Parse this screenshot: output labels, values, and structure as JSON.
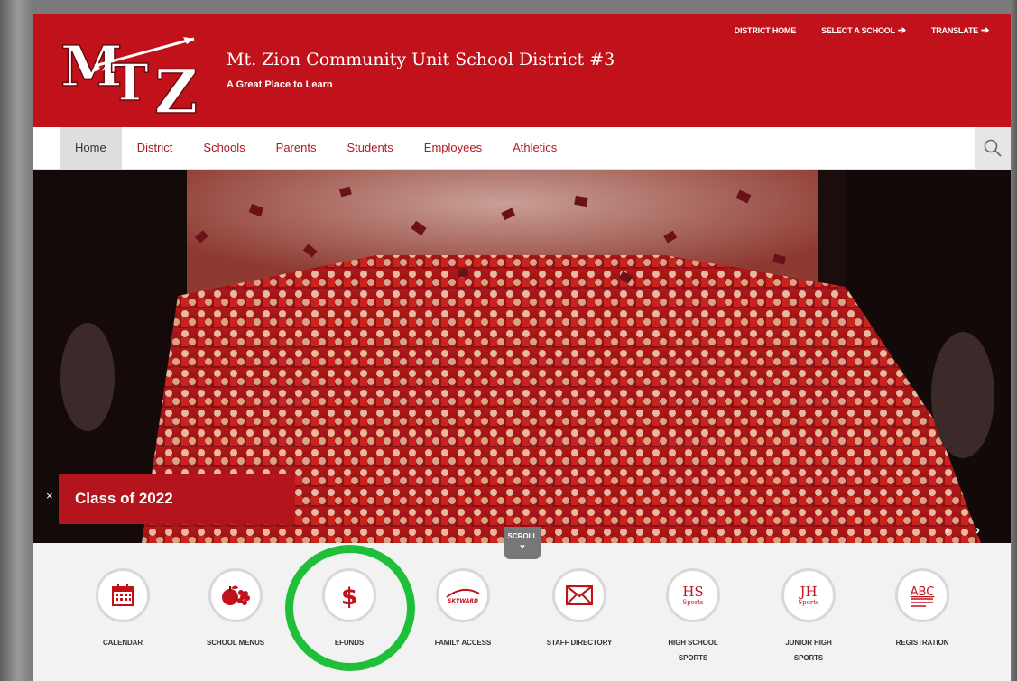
{
  "header": {
    "district_name": "Mt. Zion Community Unit School District #3",
    "tagline": "A Great Place to Learn",
    "logo_text": "MTZ",
    "utility_links": [
      {
        "label": "DISTRICT HOME",
        "arrow": ""
      },
      {
        "label": "SELECT A SCHOOL",
        "arrow": "➔"
      },
      {
        "label": "TRANSLATE",
        "arrow": "➔"
      }
    ]
  },
  "nav": {
    "items": [
      "Home",
      "District",
      "Schools",
      "Parents",
      "Students",
      "Employees",
      "Athletics"
    ],
    "active": "Home",
    "search_icon": "search-icon"
  },
  "hero": {
    "caption": "Class of 2022",
    "close": "×",
    "prev": "‹",
    "next": "›",
    "scroll_label": "SCROLL",
    "scroll_chevron": "⌄"
  },
  "quick_links": [
    {
      "label": "CALENDAR",
      "icon": "calendar-icon"
    },
    {
      "label": "SCHOOL MENUS",
      "icon": "fruit-icon"
    },
    {
      "label": "EFUNDS",
      "icon": "dollar-icon"
    },
    {
      "label": "FAMILY ACCESS",
      "icon": "skyward-icon",
      "icon_text": "SKYWARD"
    },
    {
      "label": "STAFF DIRECTORY",
      "icon": "envelope-icon"
    },
    {
      "label": "HIGH SCHOOL",
      "label2": "SPORTS",
      "icon": "hs-sports-icon",
      "icon_text": "HS",
      "icon_sub": "Sports"
    },
    {
      "label": "JUNIOR HIGH",
      "label2": "SPORTS",
      "icon": "jh-sports-icon",
      "icon_text": "JH",
      "icon_sub": "Sports"
    },
    {
      "label": "REGISTRATION",
      "icon": "abc-icon",
      "icon_text": "ABC"
    }
  ],
  "colors": {
    "brand_red": "#c1121c",
    "highlight_green": "#1fbf3a"
  }
}
